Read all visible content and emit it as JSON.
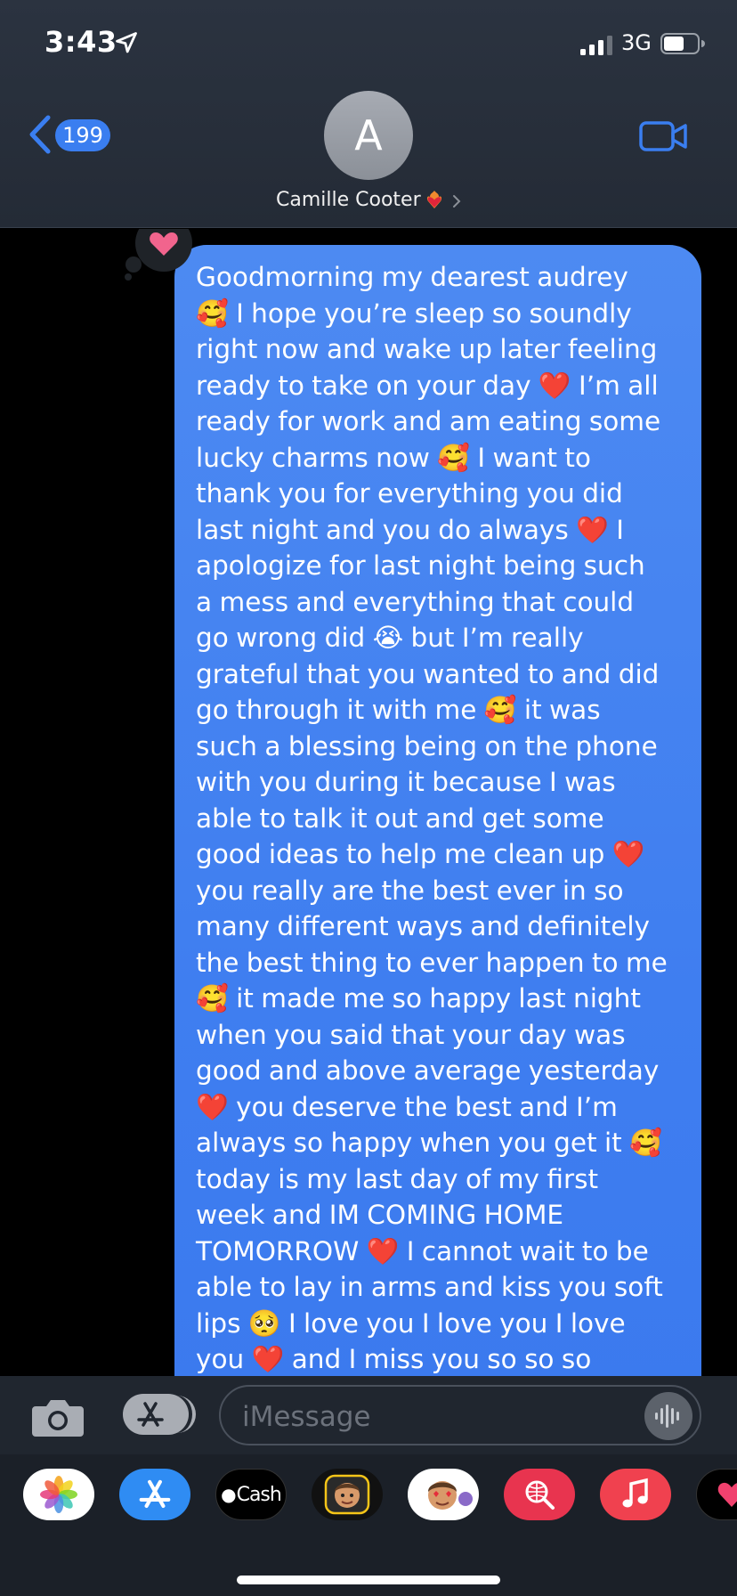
{
  "status_bar": {
    "time": "3:43",
    "network": "3G",
    "icons": [
      "location-arrow-icon",
      "signal-bars-icon",
      "battery-icon"
    ]
  },
  "nav": {
    "back_count": "199",
    "avatar_initial": "A",
    "contact_name": "Camille Cooter",
    "contact_emoji": "heart-on-fire",
    "accent_color": "#3a7ef0"
  },
  "thread": {
    "tapback": "heart",
    "bubble_color": "#3f7ef0",
    "message_text": "Goodmorning my dearest audrey\n🥰 I hope you’re sleep so soundly\nright now and wake up later feeling\nready to take on your day ❤️ I’m all\nready for work and am eating some\nlucky charms now 🥰 I want to\nthank you for everything you did\nlast night and you do always ❤️ I\napologize for last night being such\na mess and everything that could\ngo wrong did 😭 but I’m really\ngrateful that you wanted to and did\ngo through it with me 🥰 it was\nsuch a blessing being on the phone\nwith you during it because I was\nable to talk it out and get some\ngood ideas to help me clean up ❤️\nyou really are the best ever in so\nmany different ways and definitely\nthe best thing to ever happen to me\n🥰 it made me so happy last night\nwhen you said that your day was\ngood and above average yesterday\n❤️ you deserve the best and I’m\nalways so happy when you get it 🥰\ntoday is my last day of my first\nweek and IM COMING HOME\nTOMORROW ❤️ I cannot wait to be\nable to lay in arms and kiss you soft\nlips 🥺 I love you I love you I love\nyou ❤️ and I miss you so so so"
  },
  "input_bar": {
    "placeholder": "iMessage"
  },
  "app_drawer": {
    "apps": [
      {
        "name": "Photos",
        "icon": "photos-icon"
      },
      {
        "name": "App Store",
        "icon": "app-store-icon"
      },
      {
        "name": "Cash",
        "label": "Cash",
        "icon": "apple-cash-icon"
      },
      {
        "name": "Memoji",
        "icon": "memoji-icon"
      },
      {
        "name": "Memoji Stickers",
        "icon": "memoji-stickers-icon"
      },
      {
        "name": "Images Search",
        "icon": "image-search-icon"
      },
      {
        "name": "Music",
        "icon": "music-icon"
      },
      {
        "name": "Digital Touch",
        "icon": "digital-touch-icon"
      }
    ]
  }
}
